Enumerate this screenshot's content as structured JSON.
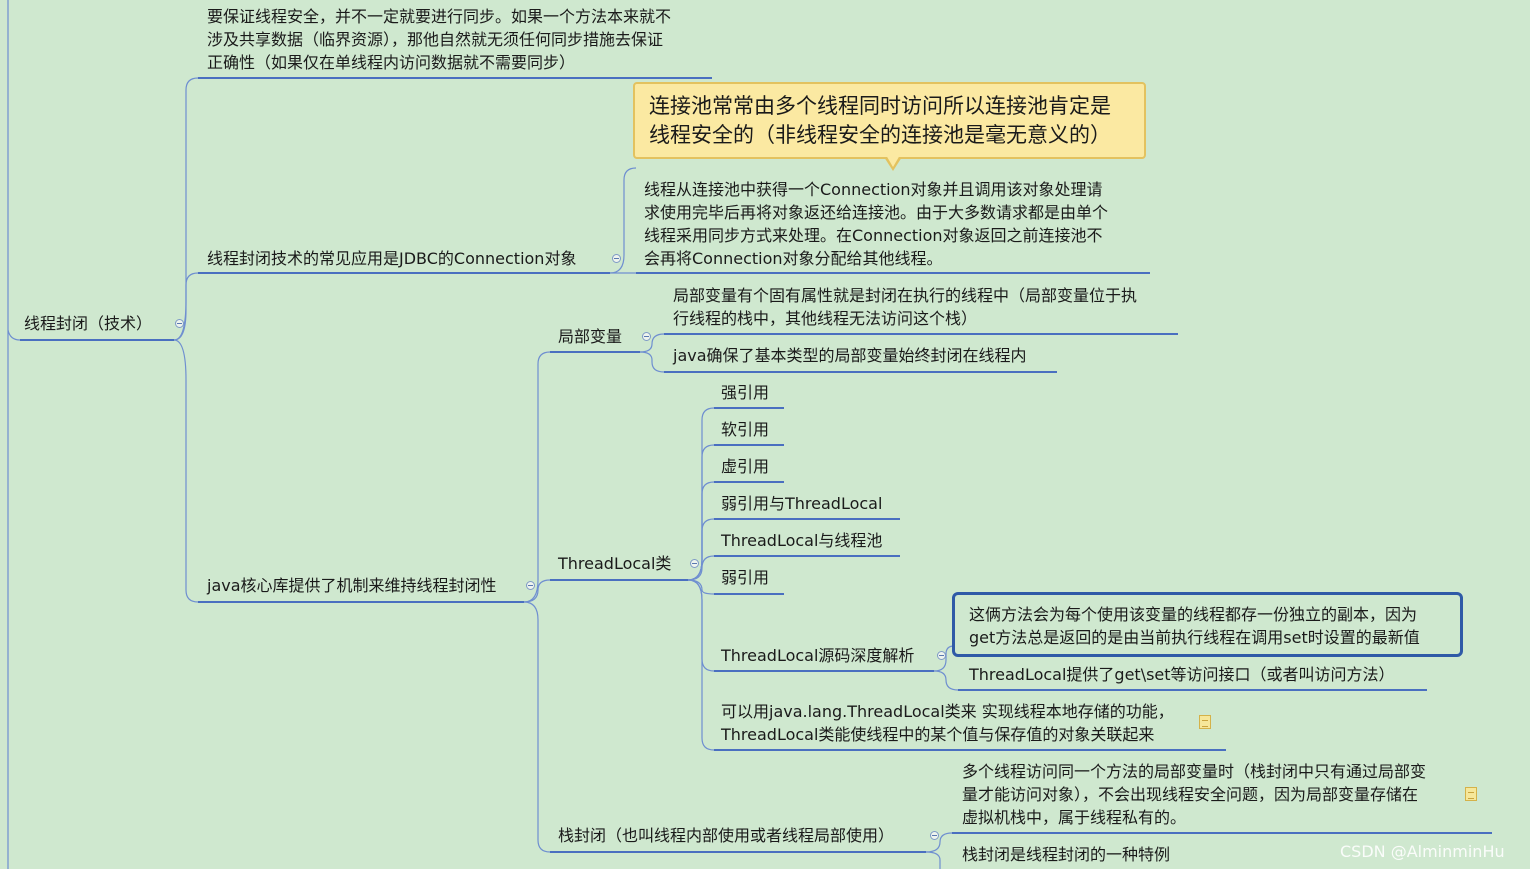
{
  "root": {
    "label": "线程封闭（技术）"
  },
  "branches": {
    "sync_note": {
      "lines": [
        "要保证线程安全，并不一定就要进行同步。如果一个方法本来就不",
        "涉及共享数据（临界资源），那他自然就无须任何同步措施去保证",
        "正确性（如果仅在单线程内访问数据就不需要同步）"
      ]
    },
    "jdbc": {
      "label": "线程封闭技术的常见应用是JDBC的Connection对象",
      "callout_lines": [
        "连接池常常由多个线程同时访问所以连接池肯定是",
        "线程安全的（非线程安全的连接池是毫无意义的）"
      ],
      "detail_lines": [
        "线程从连接池中获得一个Connection对象并且调用该对象处理请",
        "求使用完毕后再将对象返还给连接池。由于大多数请求都是由单个",
        "线程采用同步方式来处理。在Connection对象返回之前连接池不",
        "会再将Connection对象分配给其他线程。"
      ]
    },
    "java_core": {
      "label": "java核心库提供了机制来维持线程封闭性",
      "local_vars": {
        "label": "局部变量",
        "children": [
          [
            "局部变量有个固有属性就是封闭在执行的线程中（局部变量位于执",
            "行线程的栈中，其他线程无法访问这个栈）"
          ],
          [
            "java确保了基本类型的局部变量始终封闭在线程内"
          ]
        ]
      },
      "threadlocal": {
        "label": "ThreadLocal类",
        "children": [
          "强引用",
          "软引用",
          "虚引用",
          "弱引用与ThreadLocal",
          "ThreadLocal与线程池",
          "弱引用"
        ],
        "source": {
          "label": "ThreadLocal源码深度解析",
          "boxed_lines": [
            "这俩方法会为每个使用该变量的线程都存一份独立的副本，因为",
            "get方法总是返回的是由当前执行线程在调用set时设置的最新值"
          ],
          "interface": "ThreadLocal提供了get\\set等访问接口（或者叫访问方法）"
        },
        "storage_lines": [
          "可以用java.lang.ThreadLocal类来 实现线程本地存储的功能，",
          "ThreadLocal类能使线程中的某个值与保存值的对象关联起来"
        ]
      },
      "stack": {
        "label": "栈封闭（也叫线程内部使用或者线程局部使用）",
        "detail_lines": [
          "多个线程访问同一个方法的局部变量时（栈封闭中只有通过局部变",
          "量才能访问对象），不会出现线程安全问题，因为局部变量存储在",
          "虚拟机栈中，属于线程私有的。"
        ],
        "special": "栈封闭是线程封闭的一种特例"
      }
    }
  },
  "watermark": "CSDN @AlminminHu",
  "colors": {
    "background": "#cfe8cf",
    "connector": "#6f8fd0",
    "underline": "#4a6fc0",
    "callout_fill": "#fbe9a2",
    "callout_border": "#e3c25f",
    "boxed_border": "#2f5aa7"
  },
  "icons": {
    "collapse": "minus-circle-icon",
    "note": "note-icon"
  }
}
